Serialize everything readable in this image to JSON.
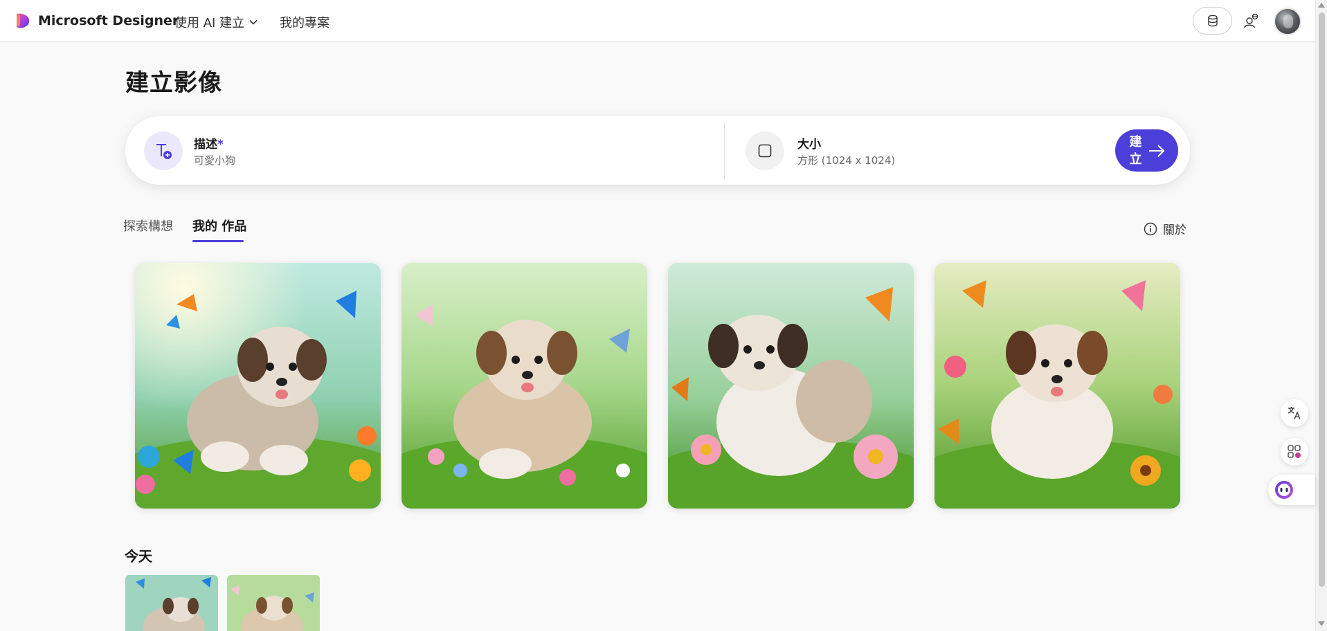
{
  "header": {
    "brand": "Microsoft Designer",
    "nav_create_ai": "使用 AI 建立",
    "nav_my_projects": "我的專案",
    "icons": [
      "designer-logo",
      "chevron-down-icon",
      "coins-icon",
      "share-people-icon",
      "avatar"
    ]
  },
  "page": {
    "title": "建立影像"
  },
  "prompt": {
    "description_label": "描述",
    "required_mark": "*",
    "description_value": "可愛小狗",
    "size_label": "大小",
    "size_value": "方形 (1024 x 1024)",
    "create_label": "建立"
  },
  "tabs": [
    {
      "label": "探索構想",
      "active": false
    },
    {
      "label": "我的 作品",
      "active": true
    }
  ],
  "about_label": "關於",
  "results": [
    {
      "alt": "puppy-butterflies-1"
    },
    {
      "alt": "puppy-butterflies-2"
    },
    {
      "alt": "puppy-butterflies-3"
    },
    {
      "alt": "puppy-butterflies-4"
    }
  ],
  "history": {
    "heading": "今天",
    "thumbnails": 2
  },
  "side_tools": [
    "translate-icon",
    "apps-icon",
    "copilot-icon"
  ],
  "colors": {
    "accent": "#4b3ed9",
    "background": "#f9f9f9"
  }
}
